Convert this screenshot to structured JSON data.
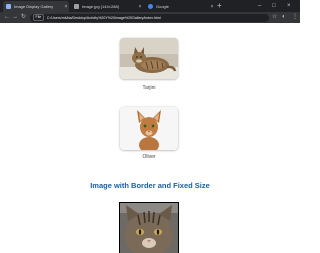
{
  "browser": {
    "tabs": [
      {
        "title": "Image Display Gallery",
        "active": true,
        "favicon_color": "#8ab4f8"
      },
      {
        "title": "Image.jpg (144×288)",
        "active": false,
        "favicon_color": "#9aa0a6"
      },
      {
        "title": "Google",
        "active": false,
        "favicon_color": "#4285f4"
      }
    ],
    "tab_close": "×",
    "new_tab": "+",
    "window_controls": [
      "–",
      "□",
      "×"
    ],
    "nav": {
      "back": "←",
      "forward": "→",
      "reload": "↻"
    },
    "site_info": "File",
    "url": "C:/Users/mk/ba/Desktop/Activity%20Y%20Image%20Gallery/index.html",
    "toolbar_icons": [
      "☆",
      "◐",
      "⋮"
    ]
  },
  "gallery": {
    "items": [
      {
        "name": "Tarjini"
      },
      {
        "name": "Oliver"
      }
    ]
  },
  "section": {
    "title": "Image with Border and Fixed Size"
  }
}
